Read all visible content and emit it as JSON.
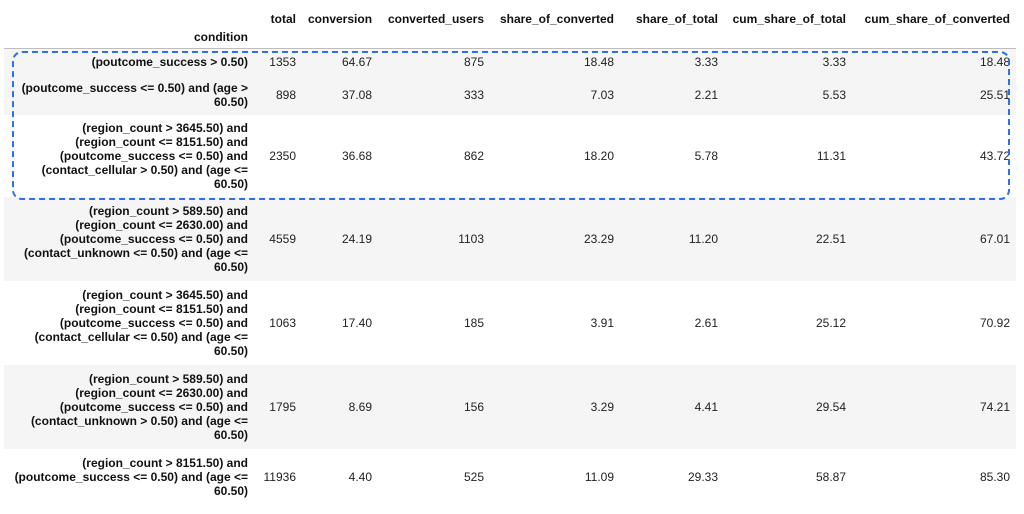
{
  "table": {
    "columns": [
      "total",
      "conversion",
      "converted_users",
      "share_of_converted",
      "share_of_total",
      "cum_share_of_total",
      "cum_share_of_converted"
    ],
    "index_name": "condition",
    "rows": [
      {
        "condition": "(poutcome_success > 0.50)",
        "values": [
          "1353",
          "64.67",
          "875",
          "18.48",
          "3.33",
          "3.33",
          "18.48"
        ]
      },
      {
        "condition": "(poutcome_success <= 0.50) and (age > 60.50)",
        "values": [
          "898",
          "37.08",
          "333",
          "7.03",
          "2.21",
          "5.53",
          "25.51"
        ]
      },
      {
        "condition": "(region_count > 3645.50) and (region_count <= 8151.50) and (poutcome_success <= 0.50) and (contact_cellular > 0.50) and (age <= 60.50)",
        "values": [
          "2350",
          "36.68",
          "862",
          "18.20",
          "5.78",
          "11.31",
          "43.72"
        ]
      },
      {
        "condition": "(region_count > 589.50) and (region_count <= 2630.00) and (poutcome_success <= 0.50) and (contact_unknown <= 0.50) and (age <= 60.50)",
        "values": [
          "4559",
          "24.19",
          "1103",
          "23.29",
          "11.20",
          "22.51",
          "67.01"
        ]
      },
      {
        "condition": "(region_count > 3645.50) and (region_count <= 8151.50) and (poutcome_success <= 0.50) and (contact_cellular <= 0.50) and (age <= 60.50)",
        "values": [
          "1063",
          "17.40",
          "185",
          "3.91",
          "2.61",
          "25.12",
          "70.92"
        ]
      },
      {
        "condition": "(region_count > 589.50) and (region_count <= 2630.00) and (poutcome_success <= 0.50) and (contact_unknown > 0.50) and (age <= 60.50)",
        "values": [
          "1795",
          "8.69",
          "156",
          "3.29",
          "4.41",
          "29.54",
          "74.21"
        ]
      },
      {
        "condition": "(region_count > 8151.50) and (poutcome_success <= 0.50) and (age <= 60.50)",
        "values": [
          "11936",
          "4.40",
          "525",
          "11.09",
          "29.33",
          "58.87",
          "85.30"
        ]
      }
    ]
  },
  "colors": {
    "highlight_border": "#2f6fe8",
    "stripe": "#f5f5f5",
    "header_rule": "#bdbdbd"
  }
}
